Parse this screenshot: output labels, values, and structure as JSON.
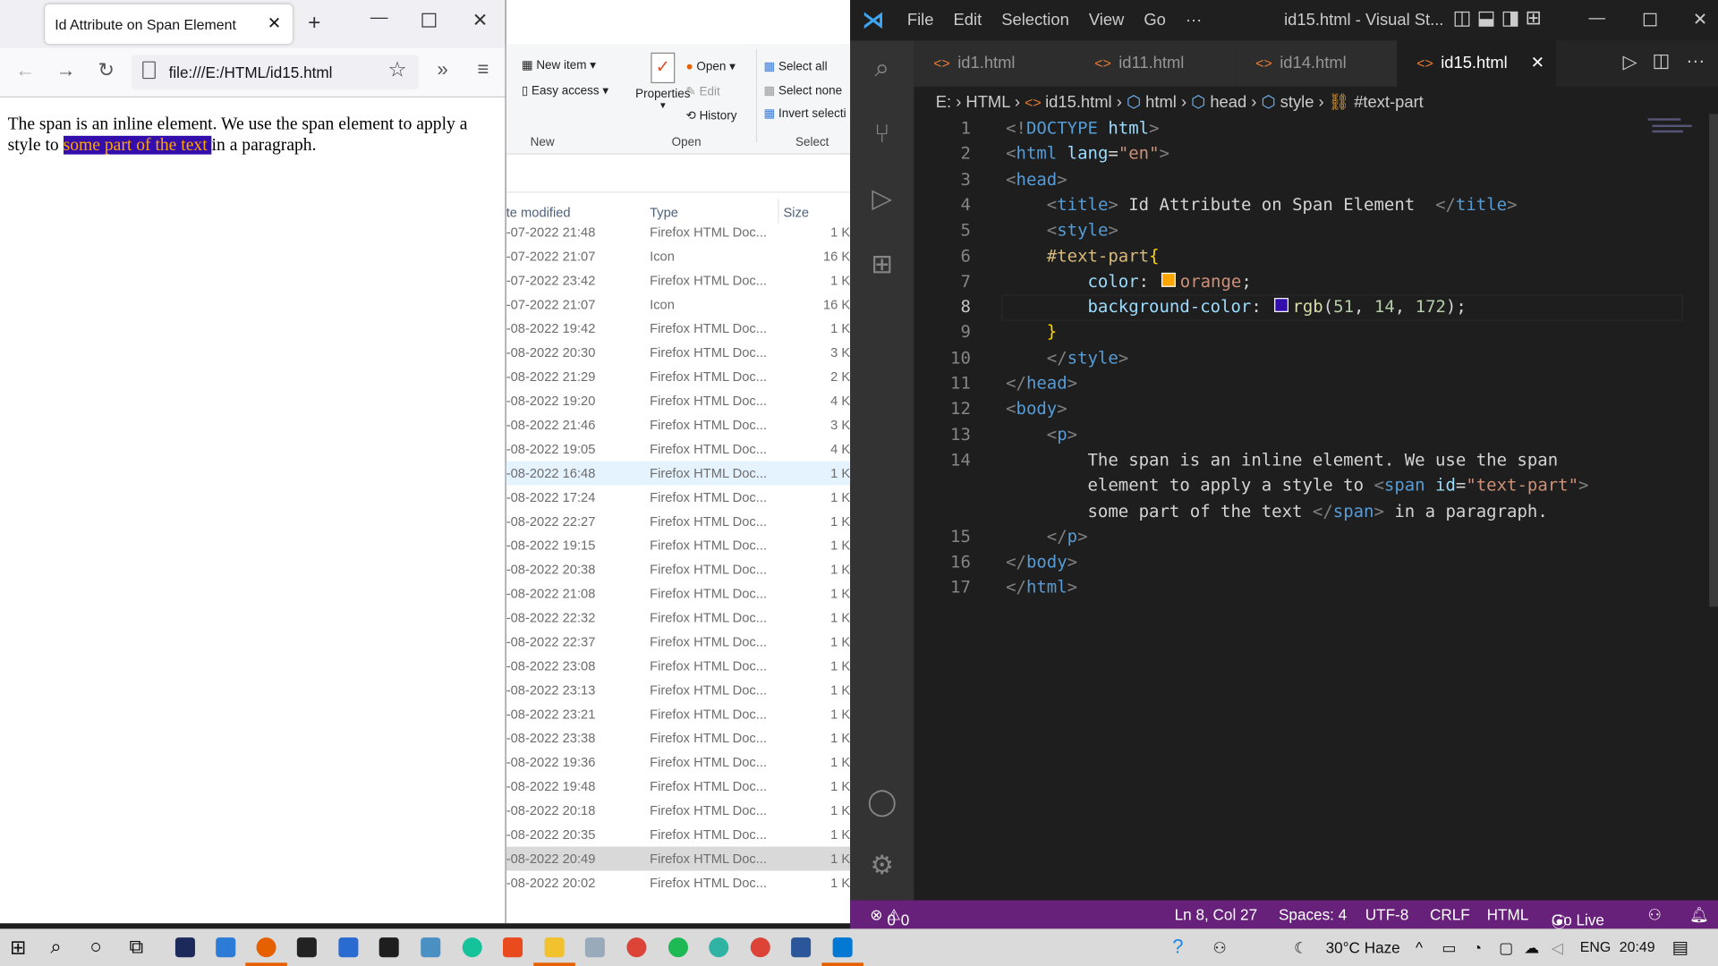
{
  "firefox": {
    "tab_title": "Id Attribute on Span Element",
    "url": "file:///E:/HTML/id15.html",
    "page": {
      "text_before": "The span is an inline element. We use the span element to apply a style to ",
      "span_text": "some part of the text ",
      "text_after": "in a paragraph.",
      "span_color": "#ffa500",
      "span_bg": "#330eac"
    }
  },
  "explorer": {
    "ribbon": {
      "new_item": "New item",
      "easy_access": "Easy access",
      "properties": "Properties",
      "open": "Open",
      "edit": "Edit",
      "history": "History",
      "select_all": "Select all",
      "select_none": "Select none",
      "invert_selection": "Invert selecti",
      "group_new": "New",
      "group_open": "Open",
      "group_select": "Select"
    },
    "columns": [
      "te modified",
      "Type",
      "Size"
    ],
    "rows": [
      [
        "-07-2022 21:48",
        "Firefox HTML Doc...",
        "1 K"
      ],
      [
        "-07-2022 21:07",
        "Icon",
        "16 K"
      ],
      [
        "-07-2022 23:42",
        "Firefox HTML Doc...",
        "1 K"
      ],
      [
        "-07-2022 21:07",
        "Icon",
        "16 K"
      ],
      [
        "-08-2022 19:42",
        "Firefox HTML Doc...",
        "1 K"
      ],
      [
        "-08-2022 20:30",
        "Firefox HTML Doc...",
        "3 K"
      ],
      [
        "-08-2022 21:29",
        "Firefox HTML Doc...",
        "2 K"
      ],
      [
        "-08-2022 19:20",
        "Firefox HTML Doc...",
        "4 K"
      ],
      [
        "-08-2022 21:46",
        "Firefox HTML Doc...",
        "3 K"
      ],
      [
        "-08-2022 19:05",
        "Firefox HTML Doc...",
        "4 K"
      ],
      [
        "-08-2022 16:48",
        "Firefox HTML Doc...",
        "1 K"
      ],
      [
        "-08-2022 17:24",
        "Firefox HTML Doc...",
        "1 K"
      ],
      [
        "-08-2022 22:27",
        "Firefox HTML Doc...",
        "1 K"
      ],
      [
        "-08-2022 19:15",
        "Firefox HTML Doc...",
        "1 K"
      ],
      [
        "-08-2022 20:38",
        "Firefox HTML Doc...",
        "1 K"
      ],
      [
        "-08-2022 21:08",
        "Firefox HTML Doc...",
        "1 K"
      ],
      [
        "-08-2022 22:32",
        "Firefox HTML Doc...",
        "1 K"
      ],
      [
        "-08-2022 22:37",
        "Firefox HTML Doc...",
        "1 K"
      ],
      [
        "-08-2022 23:08",
        "Firefox HTML Doc...",
        "1 K"
      ],
      [
        "-08-2022 23:13",
        "Firefox HTML Doc...",
        "1 K"
      ],
      [
        "-08-2022 23:21",
        "Firefox HTML Doc...",
        "1 K"
      ],
      [
        "-08-2022 23:38",
        "Firefox HTML Doc...",
        "1 K"
      ],
      [
        "-08-2022 19:36",
        "Firefox HTML Doc...",
        "1 K"
      ],
      [
        "-08-2022 19:48",
        "Firefox HTML Doc...",
        "1 K"
      ],
      [
        "-08-2022 20:18",
        "Firefox HTML Doc...",
        "1 K"
      ],
      [
        "-08-2022 20:35",
        "Firefox HTML Doc...",
        "1 K"
      ],
      [
        "-08-2022 20:49",
        "Firefox HTML Doc...",
        "1 K"
      ],
      [
        "-08-2022 20:02",
        "Firefox HTML Doc...",
        "1 K"
      ]
    ],
    "hover_row": 10,
    "selected_row": 26
  },
  "vscode": {
    "menu": [
      "File",
      "Edit",
      "Selection",
      "View",
      "Go",
      "···"
    ],
    "title": "id15.html - Visual St...",
    "tabs": [
      "id1.html",
      "id11.html",
      "id14.html",
      "id15.html"
    ],
    "active_tab": 3,
    "breadcrumb": [
      "E:",
      "HTML",
      "id15.html",
      "html",
      "head",
      "style",
      "#text-part"
    ],
    "current_line": 8,
    "lines": [
      {
        "n": "1",
        "t": [
          [
            "<!",
            "t-br"
          ],
          [
            "DOCTYPE",
            "t-tag"
          ],
          [
            " html",
            "t-attr"
          ],
          [
            ">",
            "t-br"
          ]
        ]
      },
      {
        "n": "2",
        "t": [
          [
            "<",
            "t-br"
          ],
          [
            "html",
            "t-tag"
          ],
          [
            " lang",
            "t-attr"
          ],
          [
            "=",
            "t-txt"
          ],
          [
            "\"en\"",
            "t-str"
          ],
          [
            ">",
            "t-br"
          ]
        ]
      },
      {
        "n": "3",
        "t": [
          [
            "<",
            "t-br"
          ],
          [
            "head",
            "t-tag"
          ],
          [
            ">",
            "t-br"
          ]
        ]
      },
      {
        "n": "4",
        "t": [
          [
            "    <",
            "t-br"
          ],
          [
            "title",
            "t-tag"
          ],
          [
            ">",
            "t-br"
          ],
          [
            " Id Attribute on Span Element  ",
            "t-txt"
          ],
          [
            "</",
            "t-br"
          ],
          [
            "title",
            "t-tag"
          ],
          [
            ">",
            "t-br"
          ]
        ]
      },
      {
        "n": "5",
        "t": [
          [
            "    <",
            "t-br"
          ],
          [
            "style",
            "t-tag"
          ],
          [
            ">",
            "t-br"
          ]
        ]
      },
      {
        "n": "6",
        "t": [
          [
            "    #text-part",
            "t-sel"
          ],
          [
            "{",
            "t-brace"
          ]
        ]
      },
      {
        "n": "7",
        "t": [
          [
            "        color",
            "t-attr"
          ],
          [
            ": ",
            "t-txt"
          ],
          [
            "#ffa500",
            "swatch"
          ],
          [
            "orange",
            "t-str"
          ],
          [
            ";",
            "t-txt"
          ]
        ]
      },
      {
        "n": "8",
        "t": [
          [
            "        background-color",
            "t-attr"
          ],
          [
            ": ",
            "t-txt"
          ],
          [
            "#330eac",
            "swatch"
          ],
          [
            "rgb",
            "t-fn"
          ],
          [
            "(",
            "t-txt"
          ],
          [
            "51",
            "t-num"
          ],
          [
            ", ",
            "t-txt"
          ],
          [
            "14",
            "t-num"
          ],
          [
            ", ",
            "t-txt"
          ],
          [
            "172",
            "t-num"
          ],
          [
            ");",
            "t-txt"
          ]
        ]
      },
      {
        "n": "9",
        "t": [
          [
            "    }",
            "t-brace"
          ]
        ]
      },
      {
        "n": "10",
        "t": [
          [
            "    </",
            "t-br"
          ],
          [
            "style",
            "t-tag"
          ],
          [
            ">",
            "t-br"
          ]
        ]
      },
      {
        "n": "11",
        "t": [
          [
            "</",
            "t-br"
          ],
          [
            "head",
            "t-tag"
          ],
          [
            ">",
            "t-br"
          ]
        ]
      },
      {
        "n": "12",
        "t": [
          [
            "<",
            "t-br"
          ],
          [
            "body",
            "t-tag"
          ],
          [
            ">",
            "t-br"
          ]
        ]
      },
      {
        "n": "13",
        "t": [
          [
            "    <",
            "t-br"
          ],
          [
            "p",
            "t-tag"
          ],
          [
            ">",
            "t-br"
          ]
        ]
      },
      {
        "n": "14",
        "t": [
          [
            "        The span is an inline element. We use the span",
            "t-txt"
          ]
        ]
      },
      {
        "n": "",
        "t": [
          [
            "        element to apply a style to ",
            "t-txt"
          ],
          [
            "<",
            "t-br"
          ],
          [
            "span",
            "t-tag"
          ],
          [
            " id",
            "t-attr"
          ],
          [
            "=",
            "t-txt"
          ],
          [
            "\"text-part\"",
            "t-str"
          ],
          [
            ">",
            "t-br"
          ]
        ]
      },
      {
        "n": "",
        "t": [
          [
            "        some part of the text ",
            "t-txt"
          ],
          [
            "</",
            "t-br"
          ],
          [
            "span",
            "t-tag"
          ],
          [
            ">",
            "t-br"
          ],
          [
            " in a paragraph.",
            "t-txt"
          ]
        ]
      },
      {
        "n": "15",
        "t": [
          [
            "    </",
            "t-br"
          ],
          [
            "p",
            "t-tag"
          ],
          [
            ">",
            "t-br"
          ]
        ]
      },
      {
        "n": "16",
        "t": [
          [
            "</",
            "t-br"
          ],
          [
            "body",
            "t-tag"
          ],
          [
            ">",
            "t-br"
          ]
        ]
      },
      {
        "n": "17",
        "t": [
          [
            "</",
            "t-br"
          ],
          [
            "html",
            "t-tag"
          ],
          [
            ">",
            "t-br"
          ]
        ]
      }
    ],
    "status": {
      "errors": "0",
      "warnings": "0",
      "position": "Ln 8, Col 27",
      "spaces": "Spaces: 4",
      "encoding": "UTF-8",
      "eol": "CRLF",
      "language": "HTML",
      "go_live": "Go Live"
    },
    "status_color": "#68217a"
  },
  "taskbar": {
    "weather": "30°C  Haze",
    "lang": "ENG",
    "time": "20:49"
  }
}
